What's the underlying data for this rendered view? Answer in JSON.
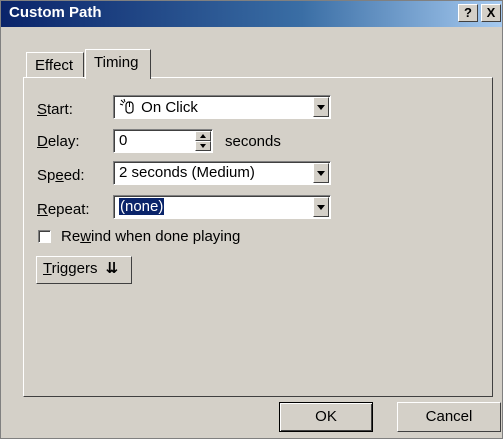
{
  "window": {
    "title": "Custom Path",
    "help_button": "?",
    "close_button": "X"
  },
  "tabs": [
    {
      "label": "Effect",
      "active": false
    },
    {
      "label": "Timing",
      "active": true
    }
  ],
  "timing": {
    "start_label": "Start:",
    "start_value": "On Click",
    "start_icon": "mouse-click-icon",
    "delay_label": "Delay:",
    "delay_value": "0",
    "delay_unit": "seconds",
    "speed_label": "Speed:",
    "speed_value": "2 seconds (Medium)",
    "repeat_label": "Repeat:",
    "repeat_value": "(none)",
    "rewind_label": "Rewind when done playing",
    "rewind_checked": false,
    "triggers_label": "Triggers",
    "triggers_icon": "double-chevron-down-icon"
  },
  "buttons": {
    "ok": "OK",
    "cancel": "Cancel"
  },
  "colors": {
    "dialog_face": "#d4d0c8",
    "titlebar_start": "#0a246a",
    "selection": "#0a246a"
  }
}
